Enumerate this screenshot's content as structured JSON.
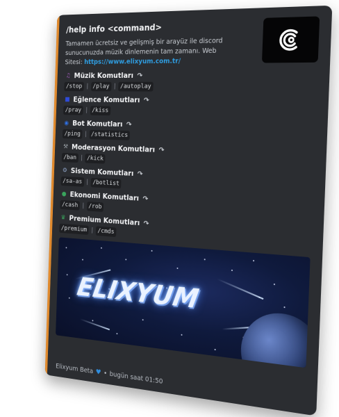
{
  "embed": {
    "title": "/help info <command>",
    "description_text": "Tamamen ücretsiz ve gelişmiş bir arayüz ile discord sunucunuzda müzik dinlemenin tam zamanı. Web Sitesi:",
    "link": "https://www.elixyum.com.tr/",
    "accent_color": "#e08a2e",
    "categories": [
      {
        "icon": "music-icon",
        "icon_color": "#9b59b6",
        "label": "Müzik Komutları",
        "commands": [
          "/stop",
          "/play",
          "/autoplay"
        ]
      },
      {
        "icon": "fun-icon",
        "icon_color": "#2f4bd8",
        "label": "Eğlence Komutları",
        "commands": [
          "/pray",
          "/kiss"
        ]
      },
      {
        "icon": "bot-icon",
        "icon_color": "#2f6fe0",
        "label": "Bot Komutları",
        "commands": [
          "/ping",
          "/statistics"
        ]
      },
      {
        "icon": "hammer-icon",
        "icon_color": "#9aa0a6",
        "label": "Moderasyon Komutları",
        "commands": [
          "/ban",
          "/kick"
        ]
      },
      {
        "icon": "gear-icon",
        "icon_color": "#8fa3c6",
        "label": "Sistem Komutları",
        "commands": [
          "/sa-as",
          "/botlist"
        ]
      },
      {
        "icon": "money-icon",
        "icon_color": "#3aa55d",
        "label": "Ekonomi Komutları",
        "commands": [
          "/cash",
          "/rob"
        ]
      },
      {
        "icon": "crown-icon",
        "icon_color": "#3aa55d",
        "label": "Premium Komutları",
        "commands": [
          "/premium",
          "/cmds"
        ]
      }
    ],
    "banner_text": "ELIXYUM",
    "footer": {
      "name": "Elixyum Beta",
      "separator": "•",
      "timestamp": "bugün saat 01:50"
    }
  }
}
